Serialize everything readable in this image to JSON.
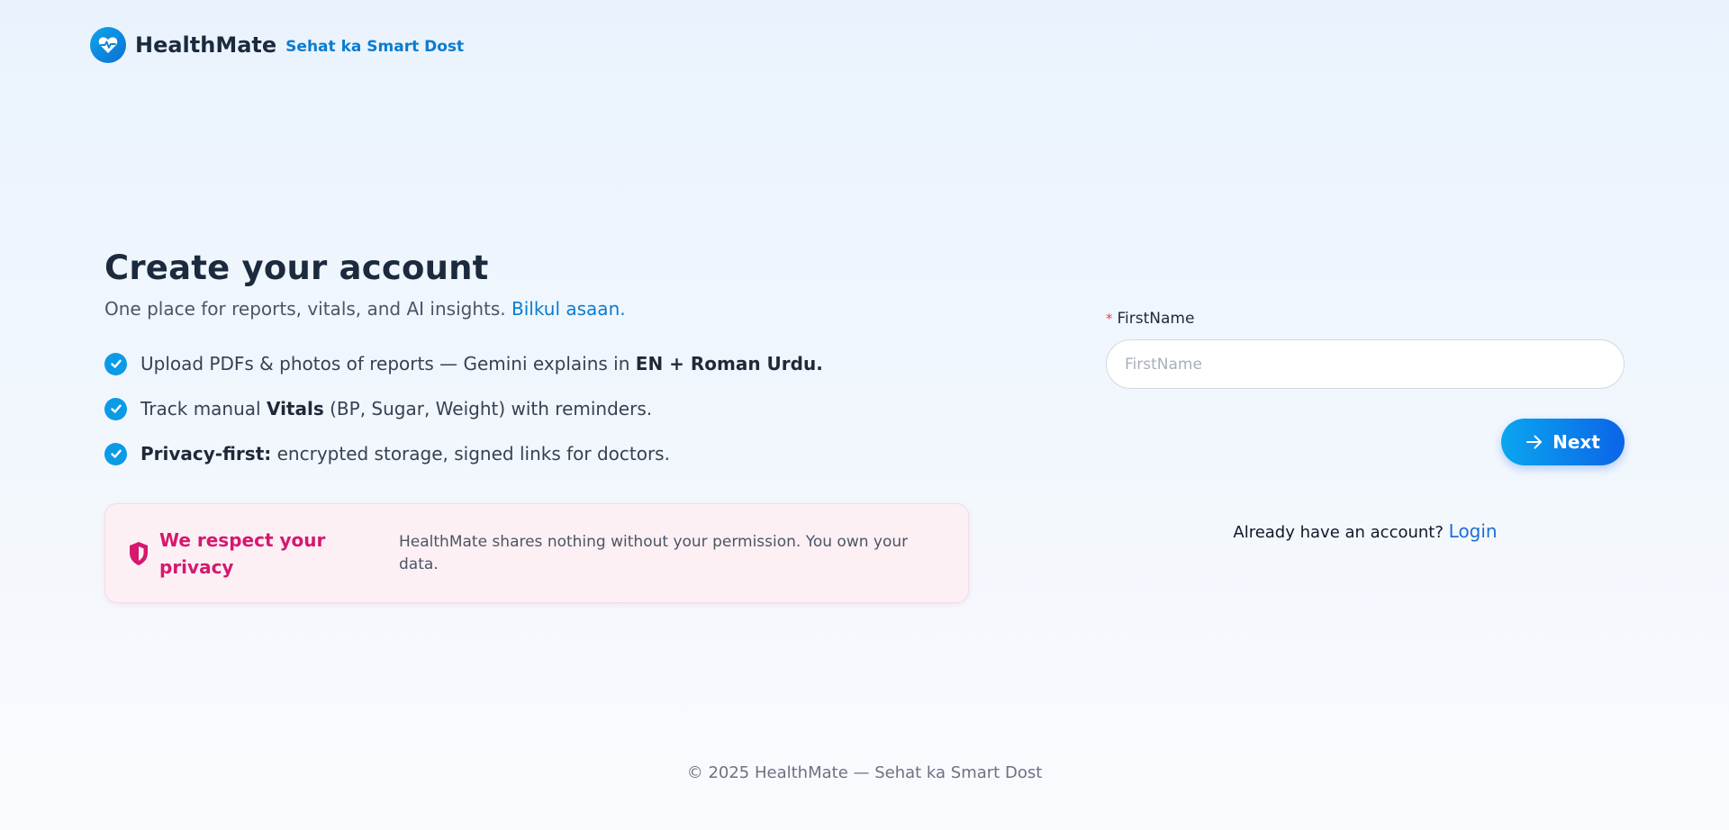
{
  "brand": {
    "name": "HealthMate",
    "tagline": "Sehat ka Smart Dost"
  },
  "hero": {
    "title": "Create your account",
    "subtitle": "One place for reports, vitals, and AI insights.",
    "subtitle_accent": "Bilkul asaan."
  },
  "features": [
    {
      "pre": "Upload PDFs & photos of reports — Gemini explains in ",
      "bold": "EN + Roman Urdu.",
      "post": ""
    },
    {
      "pre": "Track manual ",
      "bold": "Vitals",
      "post": " (BP, Sugar, Weight) with reminders."
    },
    {
      "pre": "",
      "bold": "Privacy-first:",
      "post": " encrypted storage, signed links for doctors."
    }
  ],
  "privacy": {
    "title": "We respect your privacy",
    "text": "HealthMate shares nothing without your permission. You own your data."
  },
  "form": {
    "required_mark": "*",
    "first_name_label": "FirstName",
    "first_name_placeholder": "FirstName",
    "first_name_value": "",
    "next_label": "Next",
    "login_prompt": "Already have an account?",
    "login_link": "Login"
  },
  "footer": {
    "text": "© 2025 HealthMate — Sehat ka Smart Dost"
  },
  "colors": {
    "accent": "#0a7ccf",
    "privacy_accent": "#d6186f",
    "button_start": "#0aa6ef",
    "button_end": "#0b64e8"
  },
  "icons": {
    "logo": "heart-pulse-icon",
    "feature": "check-circle-icon",
    "privacy": "shield-icon",
    "next": "arrow-right-icon"
  }
}
